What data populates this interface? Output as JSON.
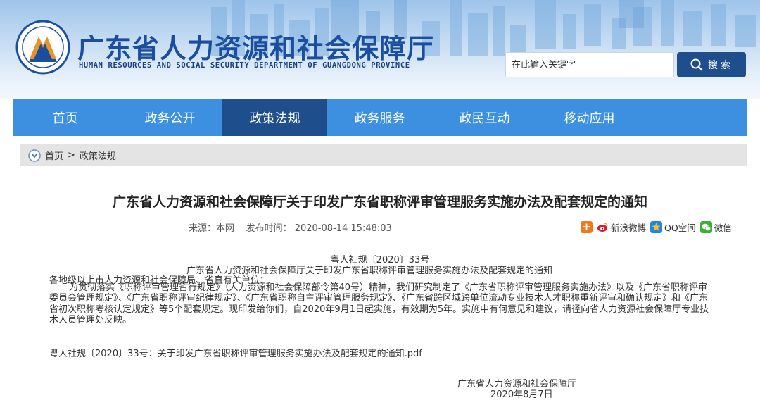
{
  "header": {
    "title": "广东省人力资源和社会保障厅",
    "subtitle": "HUMAN RESOURCES AND SOCIAL SECURITY DEPARTMENT OF GUANGDONG PROVINCE",
    "search_placeholder": "在此输入关键字",
    "search_label": "搜索"
  },
  "nav": {
    "items": [
      {
        "label": "首页"
      },
      {
        "label": "政务公开"
      },
      {
        "label": "政策法规"
      },
      {
        "label": "政务服务"
      },
      {
        "label": "政民互动"
      },
      {
        "label": "移动应用"
      }
    ],
    "active": "政策法规"
  },
  "breadcrumb": {
    "home": "首页",
    "separator": ">",
    "current": "政策法规"
  },
  "article": {
    "title": "广东省人力资源和社会保障厅关于印发广东省职称评审管理服务实施办法及配套规定的通知",
    "source_label": "来源：",
    "source": "本网",
    "published_label": "发布时间：",
    "published": "2020-08-14 15:48:03",
    "doc_number": "粤人社规〔2020〕33号",
    "doc_title": "广东省人力资源和社会保障厅关于印发广东省职称评审管理服务实施办法及配套规定的通知",
    "salutation": "各地级以上市人力资源和社会保障局、省直有关单位：",
    "paragraph": "为贯彻落实《职称评审管理暂行规定》（人力资源和社会保障部令第40号）精神，我们研究制定了《广东省职称评审管理服务实施办法》以及《广东省职称评审委员会管理规定》、《广东省职称评审纪律规定》、《广东省职称自主评审管理服务规定》、《广东省跨区域跨单位流动专业技术人才职称重新评审和确认规定》和《广东省初次职称考核认定规定》等5个配套规定。现印发给你们，自2020年9月1日起实施，有效期为5年。实施中有何意见和建议，请径向省人力资源社会保障厅专业技术人员管理处反映。",
    "attachment": "粤人社规〔2020〕33号：关于印发广东省职称评审管理服务实施办法及配套规定的通知.pdf",
    "sign_org": "广东省人力资源和社会保障厅",
    "sign_date": "2020年8月7日"
  },
  "share": {
    "weibo": "新浪微博",
    "qzone": "QQ空间",
    "wechat": "微信"
  },
  "colors": {
    "nav_bg": "#3d8fe0",
    "nav_active": "#1f4e8c",
    "title_blue": "#1a4fa0"
  }
}
